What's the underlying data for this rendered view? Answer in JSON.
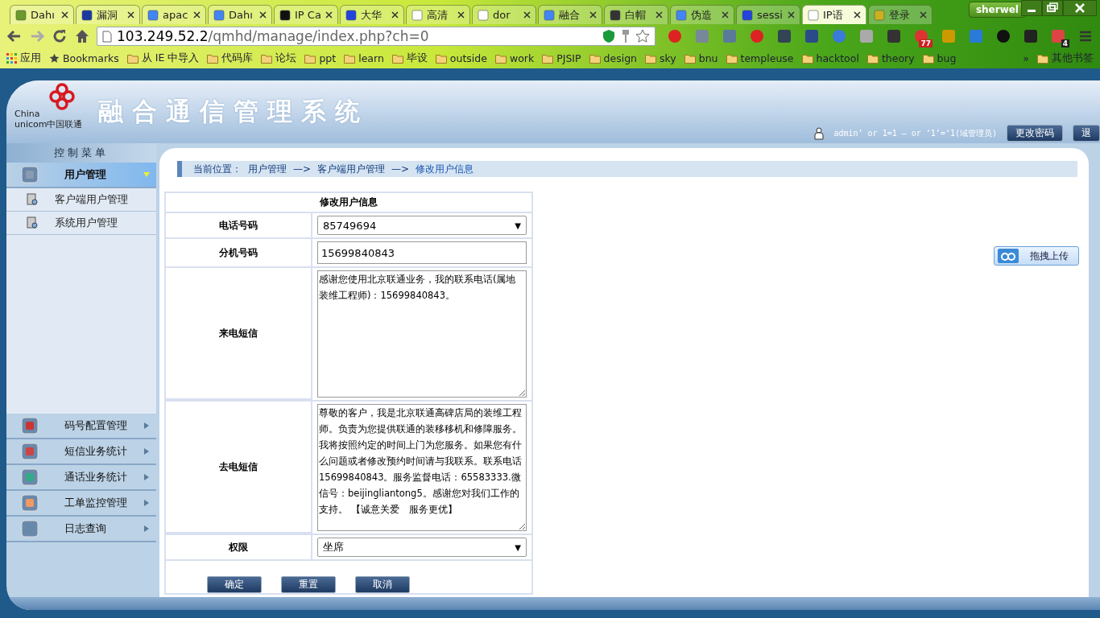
{
  "browser": {
    "tabs": [
      {
        "label": "Dahı",
        "selected": false
      },
      {
        "label": "漏洞",
        "selected": false
      },
      {
        "label": "apac",
        "selected": false
      },
      {
        "label": "Dahı",
        "selected": false
      },
      {
        "label": "IP Ca",
        "selected": false
      },
      {
        "label": "大华",
        "selected": false
      },
      {
        "label": "高清",
        "selected": false
      },
      {
        "label": "dor",
        "selected": false
      },
      {
        "label": "融合",
        "selected": false
      },
      {
        "label": "白帽",
        "selected": false
      },
      {
        "label": "伪造",
        "selected": false
      },
      {
        "label": "sessi",
        "selected": false
      },
      {
        "label": "IP语",
        "selected": true
      },
      {
        "label": "登录",
        "selected": false
      }
    ],
    "profile": "sherwel",
    "url_host": "103.249.52.2",
    "url_path": "/qmhd/manage/index.php?ch=0",
    "extension_badges": [
      "77",
      "4"
    ],
    "bookmarks": [
      "应用",
      "Bookmarks",
      "从 IE 中导入",
      "代码库",
      "论坛",
      "ppt",
      "learn",
      "毕设",
      "outside",
      "work",
      "PJSIP",
      "design",
      "sky",
      "bnu",
      "templeuse",
      "hacktool",
      "theory",
      "bug"
    ],
    "more": "»",
    "other_bookmarks": "其他书签"
  },
  "header": {
    "logo_top": "China",
    "logo_bottom": "unicom中国联通",
    "title": "融合通信管理系统",
    "user": "admin’ or 1=1 — or ‘1’=‘1(域管理员)",
    "buttons": [
      "更改密码",
      "退"
    ]
  },
  "sidebar": {
    "title": "控制菜单",
    "items": [
      {
        "label": "用户管理",
        "expanded": true,
        "selected": true,
        "children": [
          {
            "label": "客户端用户管理"
          },
          {
            "label": "系统用户管理"
          }
        ]
      },
      {
        "label": "码号配置管理",
        "expanded": false,
        "selected": false
      },
      {
        "label": "短信业务统计",
        "expanded": false,
        "selected": false
      },
      {
        "label": "通话业务统计",
        "expanded": false,
        "selected": false
      },
      {
        "label": "工单监控管理",
        "expanded": false,
        "selected": false
      },
      {
        "label": "日志查询",
        "expanded": false,
        "selected": false
      }
    ]
  },
  "breadcrumb": {
    "label": "当前位置：",
    "parts": [
      "用户管理",
      "客户端用户管理",
      "修改用户信息"
    ],
    "separator": "—>"
  },
  "form": {
    "title": "修改用户信息",
    "fields": [
      {
        "label": "电话号码",
        "kind": "select",
        "value": "85749694",
        "caret": "▼"
      },
      {
        "label": "分机号码",
        "kind": "input",
        "value": "15699840843"
      },
      {
        "label": "来电短信",
        "kind": "textarea",
        "value": "感谢您使用北京联通业务，我的联系电话(属地装维工程师)：15699840843。"
      },
      {
        "label": "去电短信",
        "kind": "textarea",
        "value": "尊敬的客户，我是北京联通高碑店局的装维工程师。负责为您提供联通的装移移机和修障服务。我将按照约定的时间上门为您服务。如果您有什么问题或者修改预约时间请与我联系。联系电话15699840843。服务监督电话：65583333.微信号：beijingliantong5。感谢您对我们工作的支持。 【诚意关爱　服务更优】"
      },
      {
        "label": "权限",
        "kind": "select",
        "value": "坐席",
        "caret": "▼"
      }
    ],
    "buttons": [
      "确定",
      "重置",
      "取消"
    ]
  },
  "upload_button": "拖拽上传"
}
